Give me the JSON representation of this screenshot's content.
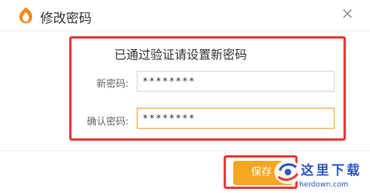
{
  "dialog": {
    "title": "修改密码",
    "headline": "已通过验证请设置新密码",
    "new_password_label": "新密码:",
    "new_password_value": "********",
    "confirm_password_label": "确认密码:",
    "confirm_password_value": "********",
    "save_label": "保存"
  },
  "watermark": {
    "name": "这里下载",
    "url": "herdown.com"
  },
  "colors": {
    "accent": "#f5a623",
    "highlight": "#e5403d",
    "watermark": "#2b56c7"
  }
}
